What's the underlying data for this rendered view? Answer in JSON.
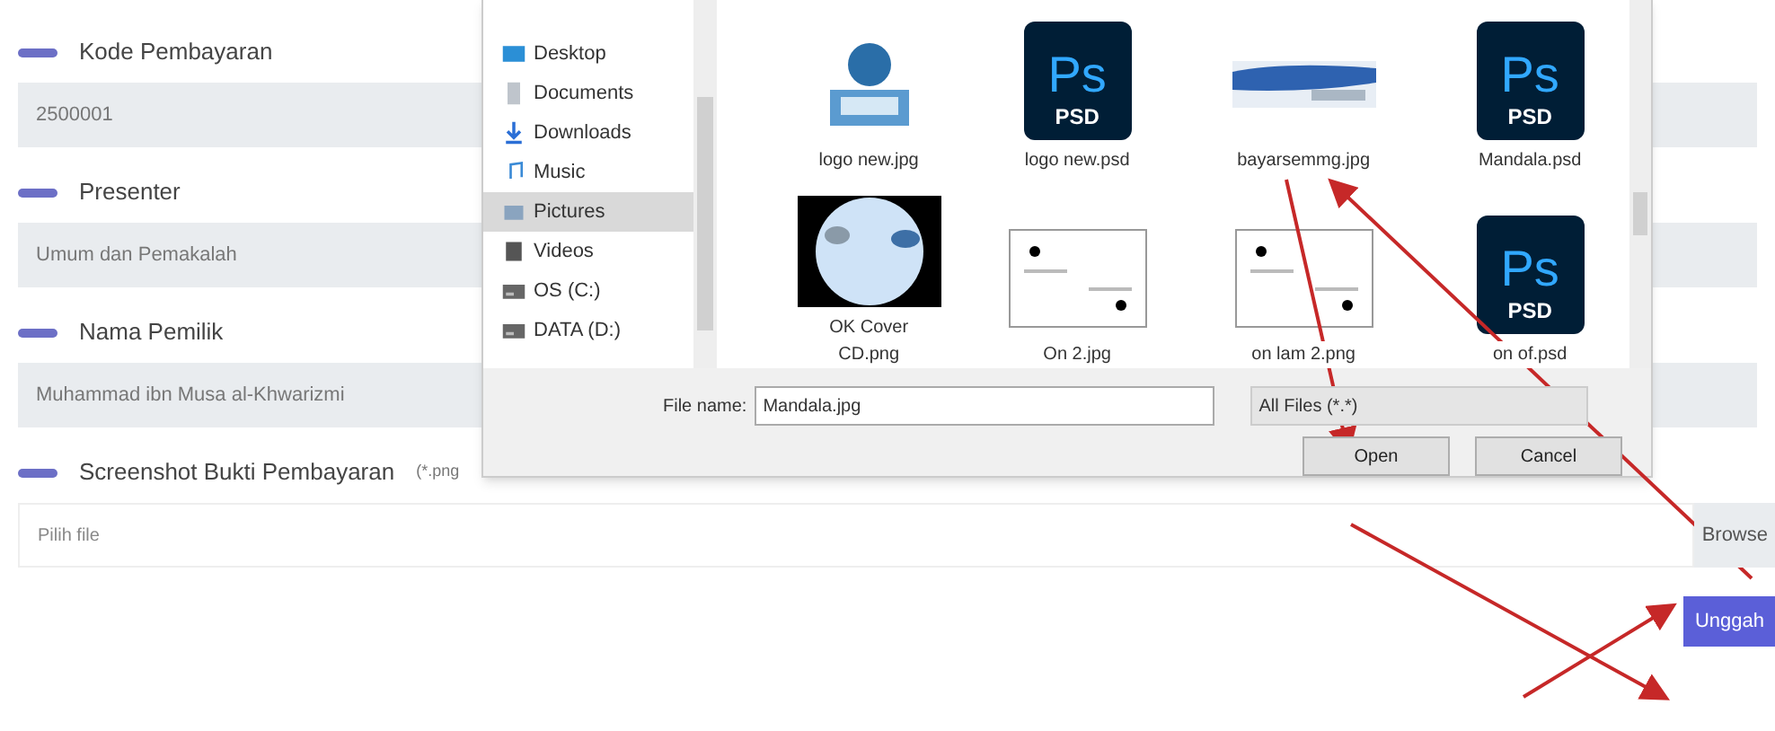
{
  "form": {
    "fields": [
      {
        "kind": "readonly",
        "label": "Kode Pembayaran",
        "value": "2500001"
      },
      {
        "kind": "readonly",
        "label": "Presenter",
        "value": "Umum dan Pemakalah"
      },
      {
        "kind": "readonly",
        "label": "Nama Pemilik",
        "value": "Muhammad ibn Musa al-Khwarizmi"
      },
      {
        "kind": "file",
        "label": "Screenshot Bukti Pembayaran",
        "hint": "(*.png",
        "placeholder": "Pilih file",
        "button": "Browse"
      }
    ],
    "submit": "Unggah"
  },
  "dialog": {
    "nav": [
      {
        "kind": "desktop",
        "label": "Desktop",
        "selected": false
      },
      {
        "kind": "documents",
        "label": "Documents",
        "selected": false
      },
      {
        "kind": "downloads",
        "label": "Downloads",
        "selected": false
      },
      {
        "kind": "music",
        "label": "Music",
        "selected": false
      },
      {
        "kind": "pictures",
        "label": "Pictures",
        "selected": true
      },
      {
        "kind": "videos",
        "label": "Videos",
        "selected": false
      },
      {
        "kind": "drive",
        "label": "OS (C:)",
        "selected": false
      },
      {
        "kind": "drive",
        "label": "DATA (D:)",
        "selected": false
      }
    ],
    "files": [
      {
        "name": "logo new.jpg"
      },
      {
        "kind": "psd",
        "name": "logo new.psd",
        "badge": "PSD",
        "mark": "Ps"
      },
      {
        "name": "bayarsemmg.jpg"
      },
      {
        "kind": "psd",
        "name": "Mandala.psd",
        "badge": "PSD",
        "mark": "Ps"
      },
      {
        "name": "OK Cover CD.png"
      },
      {
        "name": "On 2.jpg"
      },
      {
        "name": "on lam 2.png"
      },
      {
        "kind": "psd",
        "name": "on of.psd",
        "badge": "PSD",
        "mark": "Ps"
      }
    ],
    "file_name_label": "File name:",
    "file_name": "Mandala.jpg",
    "filter": "All Files (*.*)",
    "buttons": [
      "Open",
      "Cancel"
    ]
  }
}
